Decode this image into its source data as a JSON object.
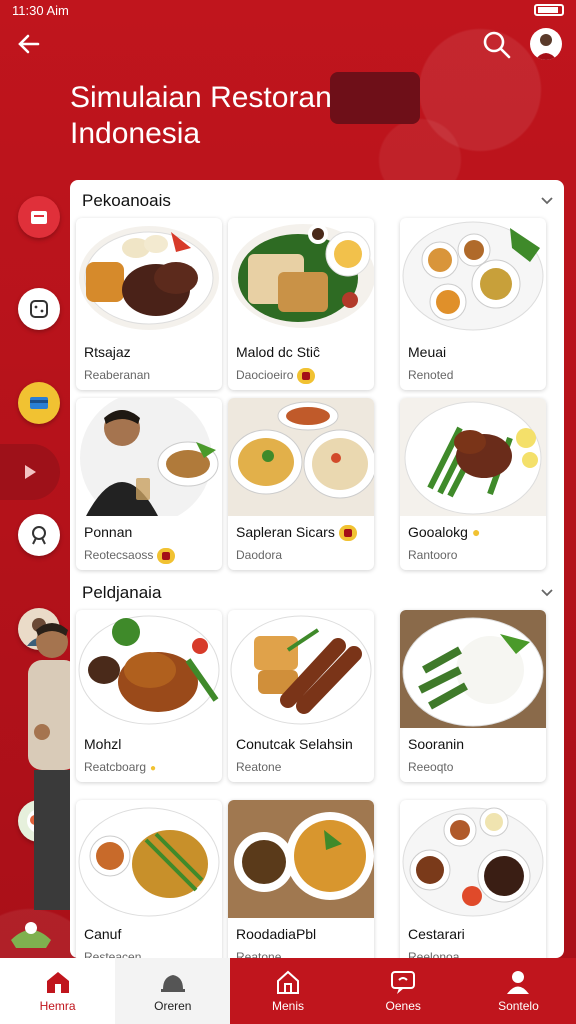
{
  "status": {
    "time": "11:30 Aim"
  },
  "header": {
    "title_line1": "Simulaian Restoran",
    "title_line2": "Indonesia"
  },
  "sections": [
    {
      "title": "Pekoanoais",
      "cards": [
        {
          "name": "Rtsajaz",
          "sub": "Reaberanan"
        },
        {
          "name": "Malod dc Stiĉ",
          "sub": "Daocioeiro"
        },
        {
          "name": "Meuai",
          "sub": "Renoted"
        },
        {
          "name": "Ponnan",
          "sub": "Reotecsaoss"
        },
        {
          "name": "Sapleran Sicars",
          "sub": "Daodora"
        },
        {
          "name": "Gooalokg",
          "sub": "Rantooro"
        }
      ]
    },
    {
      "title": "Peldjanaia",
      "cards": [
        {
          "name": "Mohzl",
          "sub": "Reatcboarg"
        },
        {
          "name": "Conutcak Selahsin",
          "sub": "Reatone"
        },
        {
          "name": "Sooranin",
          "sub": "Reeoqto"
        },
        {
          "name": "Canuf",
          "sub": "Resteacen"
        },
        {
          "name": "RoodadiaPbl",
          "sub": "Reatone"
        },
        {
          "name": "Cestarari",
          "sub": "Reelonoa"
        }
      ]
    }
  ],
  "bottom_nav": [
    {
      "label": "Hemra"
    },
    {
      "label": "Oreren"
    },
    {
      "label": "Menis"
    },
    {
      "label": "Oenes"
    },
    {
      "label": "Sontelo"
    }
  ],
  "colors": {
    "brand_red": "#c0151d",
    "badge_yellow": "#f1c232"
  },
  "icons": [
    "back-arrow-icon",
    "search-icon",
    "profile-icon",
    "chevron-down-icon",
    "home-icon",
    "menu-icon",
    "chat-icon",
    "user-icon"
  ]
}
